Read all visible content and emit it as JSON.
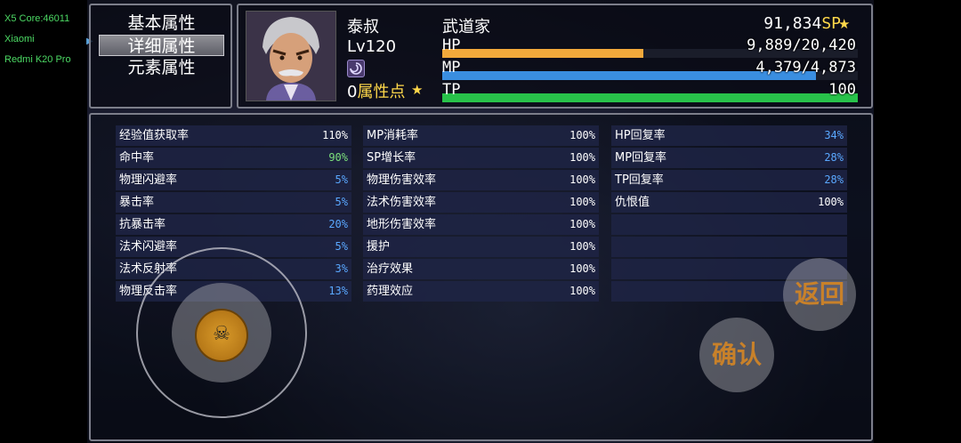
{
  "device": {
    "line1": "X5 Core:46011",
    "line2": "Xiaomi",
    "line3": "Redmi K20 Pro"
  },
  "menu": {
    "items": [
      {
        "label": "基本属性"
      },
      {
        "label": "详细属性"
      },
      {
        "label": "元素属性"
      }
    ],
    "selected_index": 1
  },
  "character": {
    "name": "泰叔",
    "level": "Lv120",
    "class": "武道家",
    "attr_points_value": "0",
    "attr_points_label": "属性点",
    "sp_value": "91,834",
    "sp_unit": "SP",
    "hp": {
      "label": "HP",
      "text": "9,889/20,420",
      "fraction": 0.4843,
      "color": "#f2a93b"
    },
    "mp": {
      "label": "MP",
      "text": "4,379/4,873",
      "fraction": 0.8986,
      "color": "#3a8ee0"
    },
    "tp": {
      "label": "TP",
      "text": "100",
      "fraction": 1.0,
      "color": "#28c24a"
    }
  },
  "stats": {
    "col1": [
      {
        "name": "经验值获取率",
        "value": "110%",
        "color": "white"
      },
      {
        "name": "命中率",
        "value": "90%",
        "color": "green"
      },
      {
        "name": "物理闪避率",
        "value": "5%",
        "color": "blue"
      },
      {
        "name": "暴击率",
        "value": "5%",
        "color": "blue"
      },
      {
        "name": "抗暴击率",
        "value": "20%",
        "color": "blue"
      },
      {
        "name": "法术闪避率",
        "value": "5%",
        "color": "blue"
      },
      {
        "name": "法术反射率",
        "value": "3%",
        "color": "blue"
      },
      {
        "name": "物理反击率",
        "value": "13%",
        "color": "blue"
      }
    ],
    "col2": [
      {
        "name": "MP消耗率",
        "value": "100%",
        "color": "white"
      },
      {
        "name": "SP增长率",
        "value": "100%",
        "color": "white"
      },
      {
        "name": "物理伤害效率",
        "value": "100%",
        "color": "white"
      },
      {
        "name": "法术伤害效率",
        "value": "100%",
        "color": "white"
      },
      {
        "name": "地形伤害效率",
        "value": "100%",
        "color": "white"
      },
      {
        "name": "援护",
        "value": "100%",
        "color": "white"
      },
      {
        "name": "治疗效果",
        "value": "100%",
        "color": "white"
      },
      {
        "name": "药理效应",
        "value": "100%",
        "color": "white"
      }
    ],
    "col3": [
      {
        "name": "HP回复率",
        "value": "34%",
        "color": "blue"
      },
      {
        "name": "MP回复率",
        "value": "28%",
        "color": "blue"
      },
      {
        "name": "TP回复率",
        "value": "28%",
        "color": "blue"
      },
      {
        "name": "仇恨值",
        "value": "100%",
        "color": "white"
      },
      {
        "name": "",
        "value": "",
        "color": "white"
      },
      {
        "name": "",
        "value": "",
        "color": "white"
      },
      {
        "name": "",
        "value": "",
        "color": "white"
      },
      {
        "name": "",
        "value": "",
        "color": "white"
      }
    ]
  },
  "buttons": {
    "back": "返回",
    "confirm": "确认"
  },
  "icons": {
    "star": "star-icon",
    "state": "swirl-state-icon",
    "joystick": "skull-icon"
  }
}
